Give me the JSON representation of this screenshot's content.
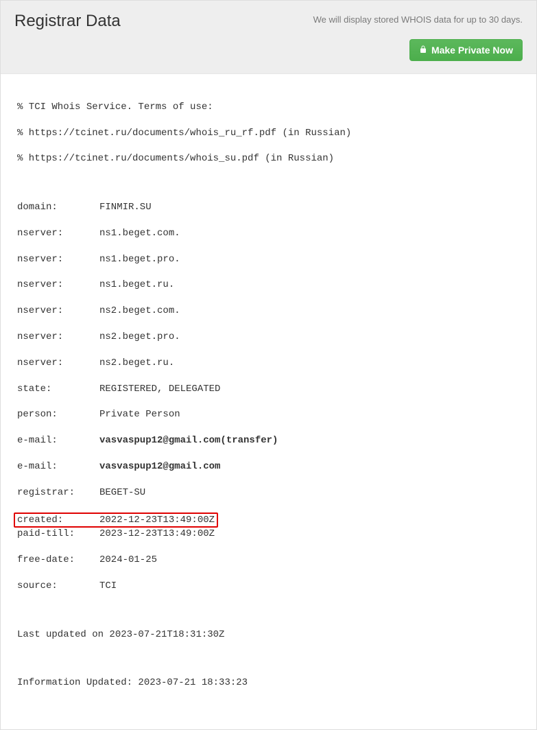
{
  "header": {
    "title": "Registrar Data",
    "notice": "We will display stored WHOIS data for up to 30 days.",
    "button_label": "Make Private Now"
  },
  "terms": {
    "line1": "% TCI Whois Service. Terms of use:",
    "line2": "% https://tcinet.ru/documents/whois_ru_rf.pdf (in Russian)",
    "line3": "% https://tcinet.ru/documents/whois_su.pdf (in Russian)"
  },
  "fields": {
    "domain_lbl": "domain:",
    "domain_val": "FINMIR.SU",
    "nserver_lbl": "nserver:",
    "nserver1": "ns1.beget.com.",
    "nserver2": "ns1.beget.pro.",
    "nserver3": "ns1.beget.ru.",
    "nserver4": "ns2.beget.com.",
    "nserver5": "ns2.beget.pro.",
    "nserver6": "ns2.beget.ru.",
    "state_lbl": "state:",
    "state_val": "REGISTERED, DELEGATED",
    "person_lbl": "person:",
    "person_val": "Private Person",
    "email_lbl": "e-mail:",
    "email1": "vasvaspup12@gmail.com(transfer)",
    "email2": "vasvaspup12@gmail.com",
    "registrar_lbl": "registrar:",
    "registrar_val": "BEGET-SU",
    "created_lbl": "created:",
    "created_val": "2022-12-23T13:49:00Z",
    "paidtill_lbl": "paid-till:",
    "paidtill_val": "2023-12-23T13:49:00Z",
    "freedate_lbl": "free-date:",
    "freedate_val": "2024-01-25",
    "source_lbl": "source:",
    "source_val": "TCI"
  },
  "footer": {
    "last_updated": "Last updated on 2023-07-21T18:31:30Z",
    "info_updated": "Information Updated: 2023-07-21 18:33:23"
  }
}
